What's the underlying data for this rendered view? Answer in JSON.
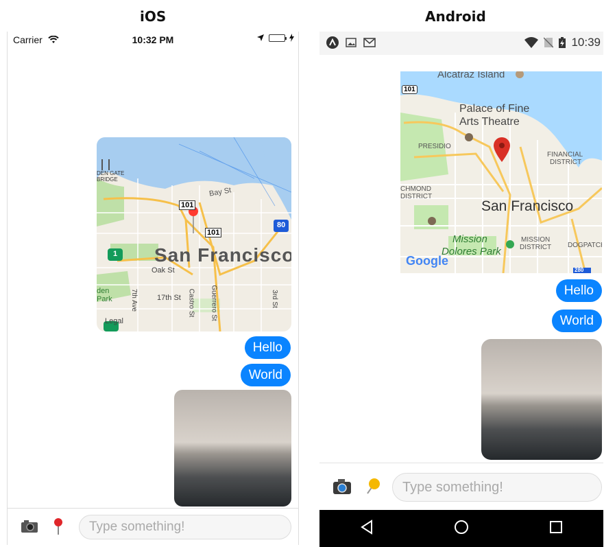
{
  "captions": {
    "ios": "iOS",
    "android": "Android"
  },
  "ios": {
    "status": {
      "carrier": "Carrier",
      "time": "10:32 PM"
    },
    "map": {
      "city": "San Francisco",
      "labels": {
        "bay_st": "Bay St",
        "oak_st": "Oak St",
        "st17": "17th St",
        "castro": "Castro St",
        "guerrero": "Guerrero St",
        "seventh_ave": "7th Ave",
        "third_st": "3rd St",
        "golden_gate": "DEN GATE",
        "bridge": "BRIDGE",
        "park_den": "den",
        "park": "Park",
        "legal": "Legal"
      },
      "shields": {
        "us101a": "101",
        "us101b": "101",
        "i80": "80",
        "ca1": "1"
      }
    },
    "messages": [
      "Hello",
      "World"
    ],
    "input_placeholder": "Type something!"
  },
  "android": {
    "status": {
      "time": "10:39"
    },
    "map": {
      "city": "San Francisco",
      "labels": {
        "alcatraz": "Alcatraz Island",
        "palace1": "Palace of Fine",
        "palace2": "Arts Theatre",
        "presidio": "PRESIDIO",
        "financial1": "FINANCIAL",
        "financial2": "DISTRICT",
        "richmond1": "CHMOND",
        "richmond2": "DISTRICT",
        "mission_dolores1": "Mission",
        "mission_dolores2": "Dolores Park",
        "mission1": "MISSION",
        "mission2": "DISTRICT",
        "dogpatch": "DOGPATCH",
        "google": "Google"
      },
      "shields": {
        "us101": "101",
        "i280": "280"
      }
    },
    "messages": [
      "Hello",
      "World"
    ],
    "input_placeholder": "Type something!"
  },
  "colors": {
    "bubble": "#0a84ff",
    "ios_pin": "#ff3b30",
    "android_pin": "#d93025",
    "map_water": "#a3ccff",
    "map_land": "#f2efe6",
    "map_park": "#bde3a6"
  }
}
